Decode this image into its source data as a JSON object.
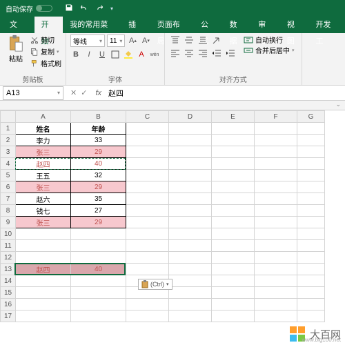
{
  "titlebar": {
    "autosave": "自动保存"
  },
  "tabs": {
    "file": "文件",
    "home": "开始",
    "custom": "我的常用菜单",
    "insert": "插入",
    "layout": "页面布局",
    "formula": "公式",
    "data": "数据",
    "review": "审阅",
    "view": "视图",
    "dev": "开发工"
  },
  "ribbon": {
    "paste": "粘贴",
    "cut": "剪切",
    "copy": "复制",
    "fmtpaint": "格式刷",
    "clipboard": "剪贴板",
    "fontname": "等线",
    "fontsize": "11",
    "fontgrp": "字体",
    "wrap": "自动换行",
    "merge": "合并后居中",
    "aligngrp": "对齐方式"
  },
  "namebox": "A13",
  "formula": "赵四",
  "headers": {
    "A": "姓名",
    "B": "年龄"
  },
  "rows": [
    {
      "a": "李力",
      "b": "33"
    },
    {
      "a": "张三",
      "b": "29"
    },
    {
      "a": "赵四",
      "b": "40"
    },
    {
      "a": "王五",
      "b": "32"
    },
    {
      "a": "张三",
      "b": "29"
    },
    {
      "a": "赵六",
      "b": "35"
    },
    {
      "a": "钱七",
      "b": "27"
    },
    {
      "a": "张三",
      "b": "29"
    }
  ],
  "pasted": {
    "a": "赵四",
    "b": "40"
  },
  "ctrl": "(Ctrl)",
  "watermark": {
    "name": "大百网",
    "url": "www.big100.net"
  },
  "chart_data": {
    "type": "table",
    "title": "",
    "columns": [
      "姓名",
      "年龄"
    ],
    "rows": [
      [
        "李力",
        33
      ],
      [
        "张三",
        29
      ],
      [
        "赵四",
        40
      ],
      [
        "王五",
        32
      ],
      [
        "张三",
        29
      ],
      [
        "赵六",
        35
      ],
      [
        "钱七",
        27
      ],
      [
        "张三",
        29
      ]
    ],
    "pasted_row": [
      "赵四",
      40
    ],
    "selection": "A13:B13",
    "copy_marquee": "A4:B4"
  }
}
